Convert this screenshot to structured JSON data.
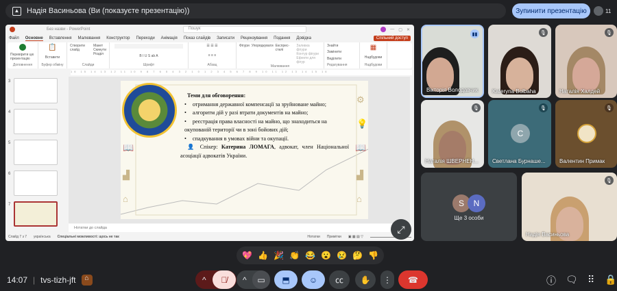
{
  "top": {
    "presenting": "Надія Васиньова (Ви (показуєте презентацію))",
    "stop_button": "Зупинити презентацію",
    "participant_count": "11"
  },
  "ppt": {
    "title": "Без назви - PowerPoint",
    "search": "Пошук",
    "tabs": [
      "Файл",
      "Основне",
      "Вставлення",
      "Малювання",
      "Конструктор",
      "Переходи",
      "Анімація",
      "Показ слайдів",
      "Записати",
      "Рецензування",
      "Подання",
      "Довідка"
    ],
    "share": "Спільний доступ",
    "groups": [
      {
        "label": "Доповнення",
        "items": [
          "Перевірити цю презентацію"
        ]
      },
      {
        "label": "Буфер обміну",
        "items": [
          "Вставити"
        ]
      },
      {
        "label": "Слайди",
        "items": [
          "Створити слайд",
          "Макет",
          "Скинути",
          "Розділ"
        ]
      },
      {
        "label": "Шрифт",
        "items": []
      },
      {
        "label": "Абзац",
        "items": []
      },
      {
        "label": "Малювання",
        "items": [
          "Фігури",
          "Упорядкувати",
          "Експрес-стилі",
          "Заливка фігури",
          "Контур фігури",
          "Ефекти для фігур"
        ]
      },
      {
        "label": "Редагування",
        "items": [
          "Знайти",
          "Замінити",
          "Виділити"
        ]
      },
      {
        "label": "Надбудови",
        "items": [
          "Надбудови"
        ]
      }
    ],
    "thumbs": [
      "3",
      "4",
      "5",
      "6",
      "7"
    ],
    "slide": {
      "heading": "Теми для обговорення:",
      "bullets": [
        "отримання державної компенсації за зруйноване майно;",
        "алгоритм дій у разі втрати документів на майно;",
        "реєстрація права власності на майно, що знаходиться на окупованій території чи в зоні бойових дій;",
        "спадкування в умовах війни та окупації."
      ],
      "speaker_prefix": "Спікер:",
      "speaker_name": "Катерина ЛОМАГА",
      "speaker_rest": ", адвокат, член Національної асоціації адвокатів України."
    },
    "notes_placeholder": "Нотатки до слайда",
    "status": {
      "slide": "Слайд 7 з 7",
      "lang": "українська",
      "accessibility": "Спеціальні можливості: щось не так",
      "notes": "Нотатки",
      "comments": "Примітки"
    }
  },
  "tiles": [
    {
      "name": "Вікторія Володавчик",
      "speaking": true
    },
    {
      "name": "Kateryna Bolbaha"
    },
    {
      "name": "Наталія Халдей"
    },
    {
      "name": "Наталія ШВЕРНЕН..."
    },
    {
      "name": "Светлана Бурнаше...",
      "initial": "С"
    },
    {
      "name": "Валентин Примак"
    },
    {
      "name": "Надія Васиньова"
    }
  ],
  "others": {
    "label": "Ще 3 особи",
    "initials": [
      "S",
      "N"
    ]
  },
  "reactions": [
    "💖",
    "👍",
    "🎉",
    "👏",
    "😂",
    "😮",
    "😢",
    "🤔",
    "👎"
  ],
  "bottom": {
    "time": "14:07",
    "code": "tvs-tizh-jft"
  }
}
